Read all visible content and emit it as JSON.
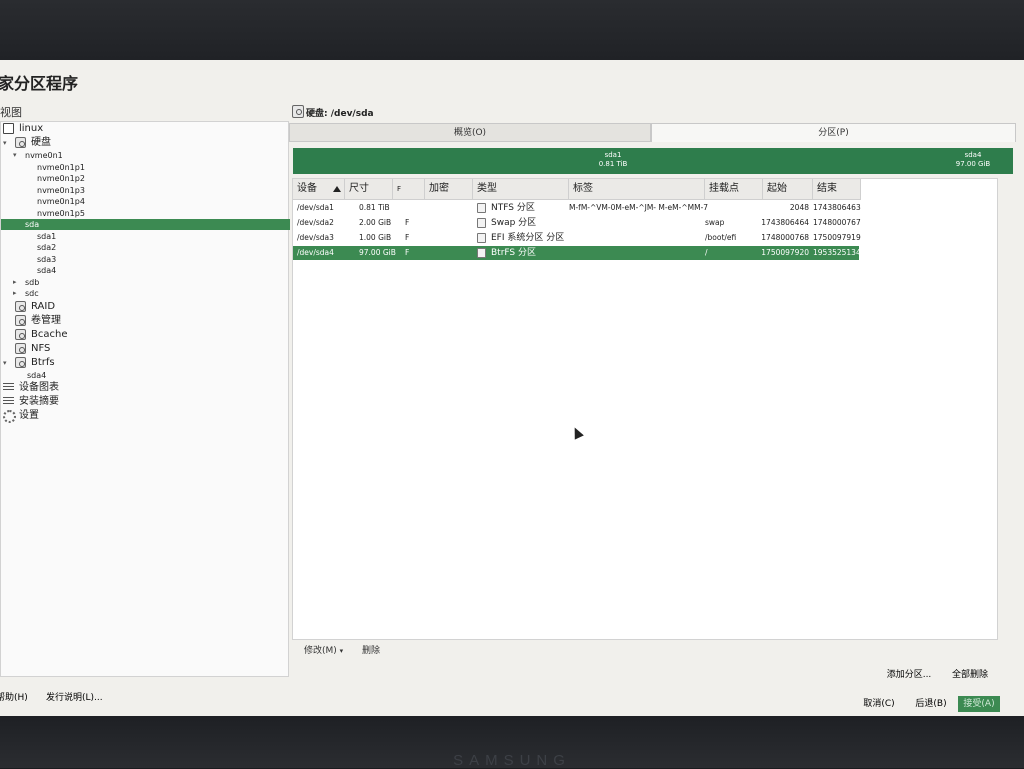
{
  "app": {
    "title": "家分区程序"
  },
  "left_panel": {
    "header": "视图"
  },
  "tree": [
    {
      "label": "linux",
      "level": 0,
      "icon": "monitor-icon"
    },
    {
      "label": "硬盘",
      "level": 1,
      "icon": "disk-icon",
      "expanded": true
    },
    {
      "label": "nvme0n1",
      "level": 2,
      "expanded": true
    },
    {
      "label": "nvme0n1p1",
      "level": 3
    },
    {
      "label": "nvme0n1p2",
      "level": 3
    },
    {
      "label": "nvme0n1p3",
      "level": 3
    },
    {
      "label": "nvme0n1p4",
      "level": 3
    },
    {
      "label": "nvme0n1p5",
      "level": 3
    },
    {
      "label": "sda",
      "level": 2,
      "selected": true
    },
    {
      "label": "sda1",
      "level": 3
    },
    {
      "label": "sda2",
      "level": 3
    },
    {
      "label": "sda3",
      "level": 3
    },
    {
      "label": "sda4",
      "level": 3
    },
    {
      "label": "sdb",
      "level": 2,
      "collapsed": true
    },
    {
      "label": "sdc",
      "level": 2,
      "collapsed": true
    },
    {
      "label": "RAID",
      "level": 1,
      "icon": "raid-icon"
    },
    {
      "label": "卷管理",
      "level": 1,
      "icon": "volume-icon"
    },
    {
      "label": "Bcache",
      "level": 1,
      "icon": "bcache-icon"
    },
    {
      "label": "NFS",
      "level": 1,
      "icon": "nfs-icon"
    },
    {
      "label": "Btrfs",
      "level": 1,
      "icon": "btrfs-icon",
      "expanded": true
    },
    {
      "label": "sda4",
      "level": 2
    },
    {
      "label": "设备图表",
      "level": 0,
      "icon": "list-icon"
    },
    {
      "label": "安装摘要",
      "level": 0,
      "icon": "list-icon"
    },
    {
      "label": "设置",
      "level": 0,
      "icon": "gear-icon"
    }
  ],
  "right_panel": {
    "header": "硬盘: /dev/sda",
    "tabs": [
      {
        "label": "概览(O)"
      },
      {
        "label": "分区(P)",
        "active": true
      }
    ],
    "graph": [
      {
        "name": "sda1",
        "size": "0.81 TiB"
      },
      {
        "name": "sda4",
        "size": "97.00 GiB"
      }
    ],
    "columns": [
      "设备",
      "尺寸",
      "F",
      "加密",
      "类型",
      "标签",
      "挂载点",
      "起始",
      "结束"
    ],
    "rows": [
      {
        "device": "/dev/sda1",
        "size": "0.81 TiB",
        "f": "",
        "encrypted": "",
        "type": "NTFS 分区",
        "label": "M-fM-^VM-0M-eM-^JM- M-eM-^MM-7",
        "mount": "",
        "start": "2048",
        "end": "1743806463"
      },
      {
        "device": "/dev/sda2",
        "size": "2.00 GiB",
        "f": "F",
        "encrypted": "",
        "type": "Swap 分区",
        "label": "",
        "mount": "swap",
        "start": "1743806464",
        "end": "1748000767"
      },
      {
        "device": "/dev/sda3",
        "size": "1.00 GiB",
        "f": "F",
        "encrypted": "",
        "type": "EFI 系统分区 分区",
        "label": "",
        "mount": "/boot/efi",
        "start": "1748000768",
        "end": "1750097919"
      },
      {
        "device": "/dev/sda4",
        "size": "97.00 GiB",
        "f": "F",
        "encrypted": "",
        "type": "BtrFS 分区",
        "label": "",
        "mount": "/",
        "start": "1750097920",
        "end": "1953525134",
        "selected": true
      }
    ],
    "actions": {
      "modify": "修改(M)",
      "delete": "删除"
    }
  },
  "bottom": {
    "add_partition": "添加分区...",
    "delete_all": "全部删除",
    "help": "帮助(H)",
    "release_notes": "发行说明(L)...",
    "cancel": "取消(C)",
    "back": "后退(B)",
    "next": "接受(A)"
  },
  "colors": {
    "accent": "#3c8a52",
    "graph": "#2e7d4c"
  }
}
